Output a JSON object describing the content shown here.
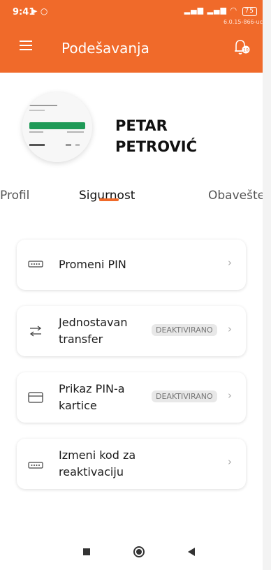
{
  "status_bar": {
    "time": "9:41",
    "battery": "75",
    "version": "6.0.15-866-uc"
  },
  "app_bar": {
    "title": "Podešavanja",
    "notification_count": "10"
  },
  "profile": {
    "first_name": "PETAR",
    "last_name": "PETROVIĆ"
  },
  "tabs": [
    {
      "label": "Profil"
    },
    {
      "label": "Sigurnost",
      "active": true
    },
    {
      "label": "Obavešte"
    }
  ],
  "settings": [
    {
      "label_line1": "Promeni PIN",
      "label_line2": "",
      "badge": "",
      "icon": "pin-dots-icon"
    },
    {
      "label_line1": "Jednostavan",
      "label_line2": "transfer",
      "badge": "DEAKTIVIRANO",
      "icon": "swap-arrows-icon"
    },
    {
      "label_line1": "Prikaz PIN-a",
      "label_line2": "kartice",
      "badge": "DEAKTIVIRANO",
      "icon": "card-icon"
    },
    {
      "label_line1": "Izmeni kod za",
      "label_line2": "reaktivaciju",
      "badge": "",
      "icon": "pin-dots-icon"
    }
  ],
  "colors": {
    "accent": "#f06a2a",
    "badge_bg": "#e8e8e8"
  }
}
